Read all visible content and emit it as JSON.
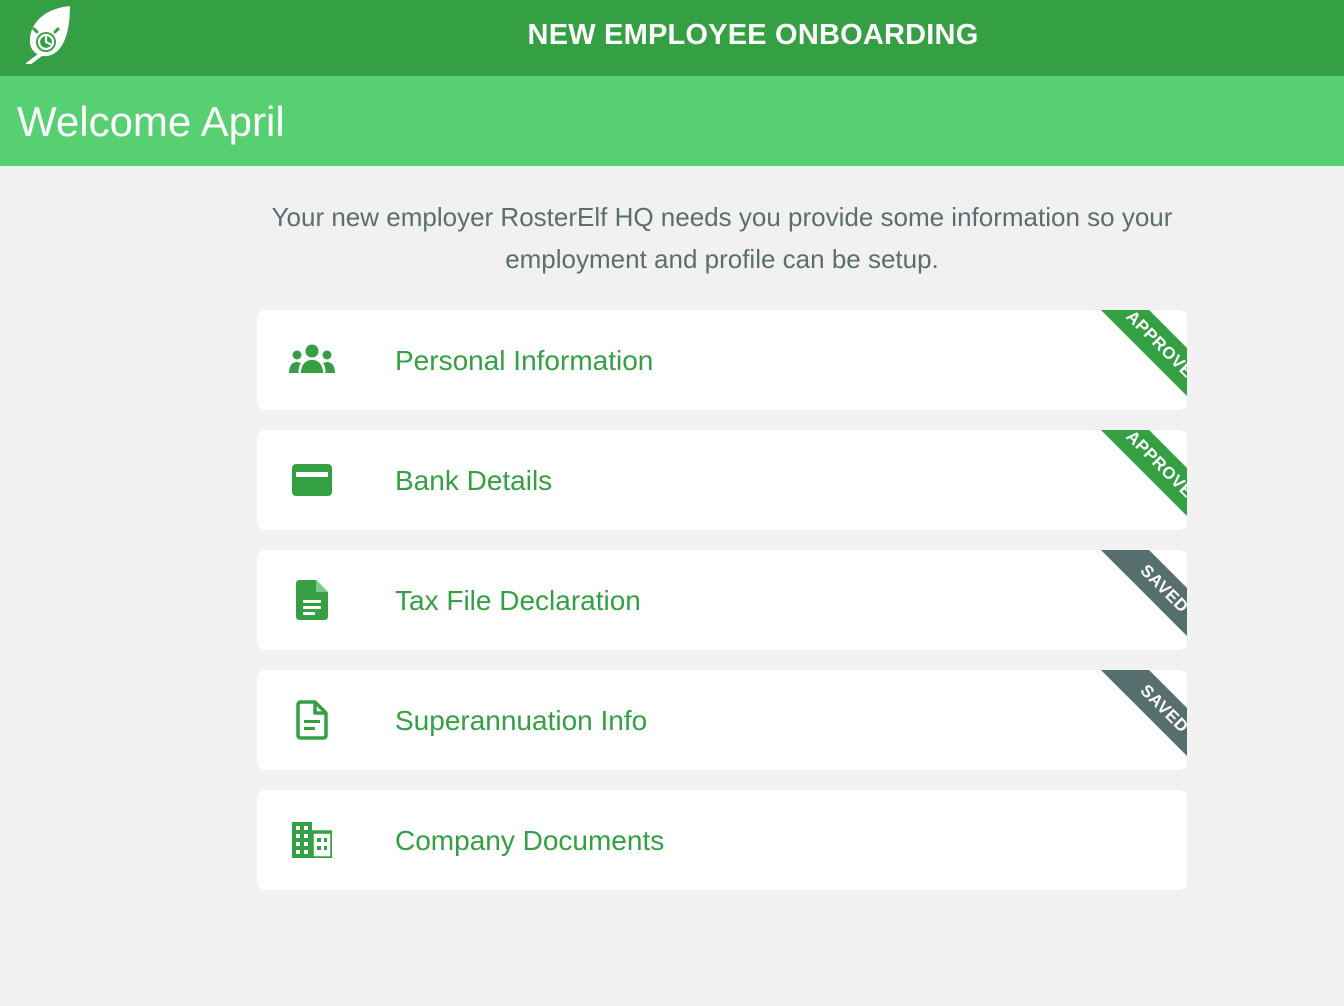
{
  "header": {
    "title": "NEW EMPLOYEE ONBOARDING",
    "logo_icon": "rosterelf-leaf-clock-logo-icon"
  },
  "welcome": {
    "title": "Welcome April"
  },
  "intro": {
    "text": "Your new employer RosterElf HQ needs you provide some information so your employment and profile can be setup."
  },
  "sections": [
    {
      "label": "Personal Information",
      "icon": "people-group-icon",
      "status": "APPROVED"
    },
    {
      "label": "Bank Details",
      "icon": "credit-card-icon",
      "status": "APPROVED"
    },
    {
      "label": "Tax File Declaration",
      "icon": "document-filled-icon",
      "status": "SAVED"
    },
    {
      "label": "Superannuation Info",
      "icon": "document-outline-icon",
      "status": "SAVED"
    },
    {
      "label": "Company Documents",
      "icon": "building-icon",
      "status": ""
    }
  ],
  "colors": {
    "primary": "#34a043",
    "welcome_bar": "#57d072",
    "saved_ribbon": "#566f6e",
    "background": "#f1f1f1"
  }
}
